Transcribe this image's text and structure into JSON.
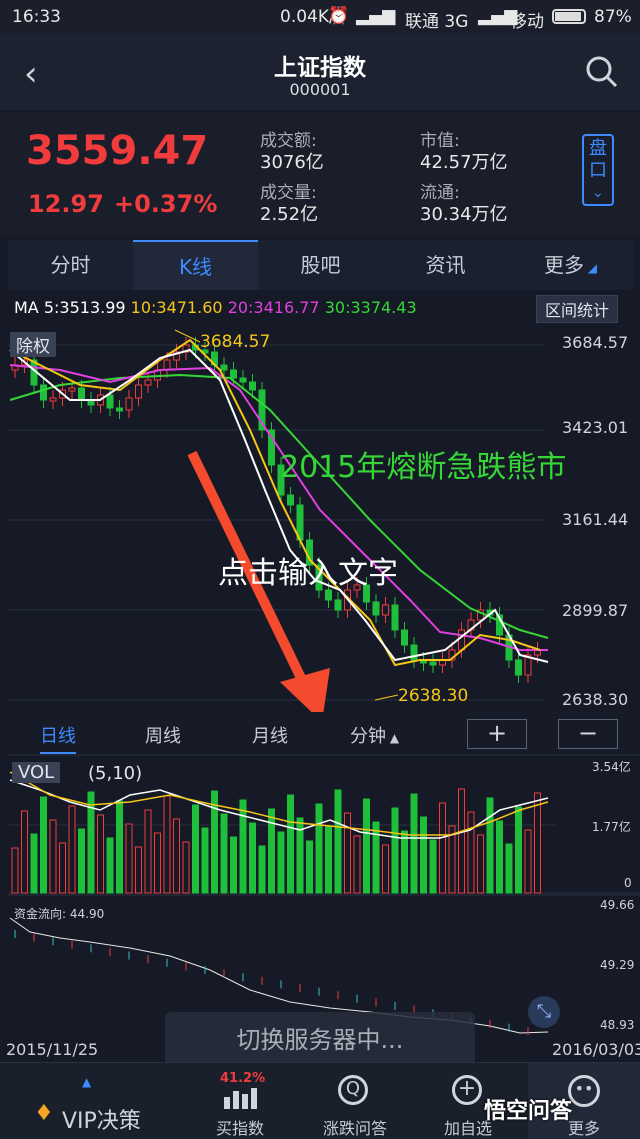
{
  "status_bar": {
    "time": "16:33",
    "speed": "0.04K/s",
    "carrier1": "联通 3G",
    "carrier2": "移动",
    "battery": "87%"
  },
  "header": {
    "title": "上证指数",
    "code": "000001"
  },
  "quote": {
    "price": "3559.47",
    "change": "12.97",
    "change_pct": "+0.37%",
    "turnover_label": "成交额:",
    "turnover": "3076亿",
    "volume_label": "成交量:",
    "volume": "2.52亿",
    "mktcap_label": "市值:",
    "mktcap": "42.57万亿",
    "float_label": "流通:",
    "float": "30.34万亿",
    "pankou": [
      "盘",
      "口"
    ]
  },
  "tabs": [
    "分时",
    "K线",
    "股吧",
    "资讯",
    "更多"
  ],
  "ma": {
    "ma5": "MA 5:3513.99",
    "ma10": "10:3471.60",
    "ma20": "20:3416.77",
    "ma30": "30:3374.43"
  },
  "interval_stats": "区间统计",
  "chuquan": "除权",
  "price_axis": [
    "3684.57",
    "3423.01",
    "3161.44",
    "2899.87",
    "2638.30"
  ],
  "high_label": "3684.57",
  "low_label": "2638.30",
  "annotation_green": "2015年熔断急跌熊市",
  "annotation_white": "点击输入文字",
  "periods": [
    "日线",
    "周线",
    "月线",
    "分钟"
  ],
  "zoom": {
    "plus": "+",
    "minus": "−"
  },
  "vol": {
    "label": "VOL",
    "params": "(5,10)",
    "axis": [
      "3.54亿",
      "1.77亿",
      "0"
    ]
  },
  "flow": {
    "label": "资金流向: 44.90",
    "axis": [
      "49.66",
      "49.29",
      "48.93"
    ]
  },
  "dates": {
    "start": "2015/11/25",
    "end": "2016/03/03"
  },
  "toast": "切换服务器中...",
  "bottom_nav": [
    {
      "label": "VIP决策"
    },
    {
      "label": "买指数",
      "badge": "41.2%"
    },
    {
      "label": "涨跌问答"
    },
    {
      "label": "加自选"
    },
    {
      "label": "更多"
    }
  ],
  "watermark": "悟空问答",
  "colors": {
    "up": "#f03c3c",
    "down": "#1fbf3c",
    "accent": "#3d8bff",
    "ma5": "#ffffff",
    "ma10": "#f5c518",
    "ma20": "#e040e0",
    "ma30": "#36d636"
  }
}
